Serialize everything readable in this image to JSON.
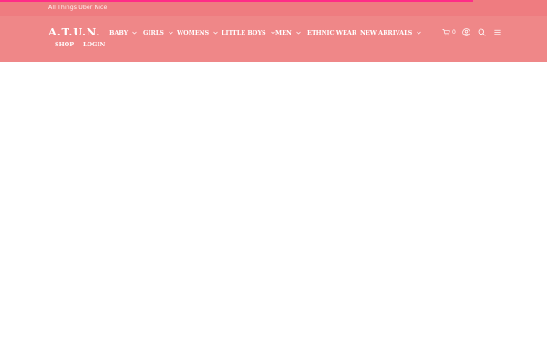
{
  "topbar": {
    "tagline": "All Things Uber Nice",
    "accent_color": "#ff2d87",
    "background_color": "#ef7c80"
  },
  "header": {
    "logo": "A.T.U.N.",
    "background_color": "#ef8788",
    "nav": [
      {
        "label": "BABY",
        "has_dropdown": true
      },
      {
        "label": "GIRLS",
        "has_dropdown": true
      },
      {
        "label": "WOMENS",
        "has_dropdown": true
      },
      {
        "label": "LITTLE BOYS",
        "has_dropdown": true
      },
      {
        "label": "MEN",
        "has_dropdown": true
      },
      {
        "label": "ETHNIC WEAR",
        "has_dropdown": false
      },
      {
        "label": "NEW ARRIVALS",
        "has_dropdown": true
      },
      {
        "label": "SHOP",
        "has_dropdown": false
      },
      {
        "label": "LOGIN",
        "has_dropdown": false
      }
    ],
    "cart_count": "0",
    "icons": [
      "cart-icon",
      "user-icon",
      "search-icon",
      "menu-icon"
    ]
  }
}
